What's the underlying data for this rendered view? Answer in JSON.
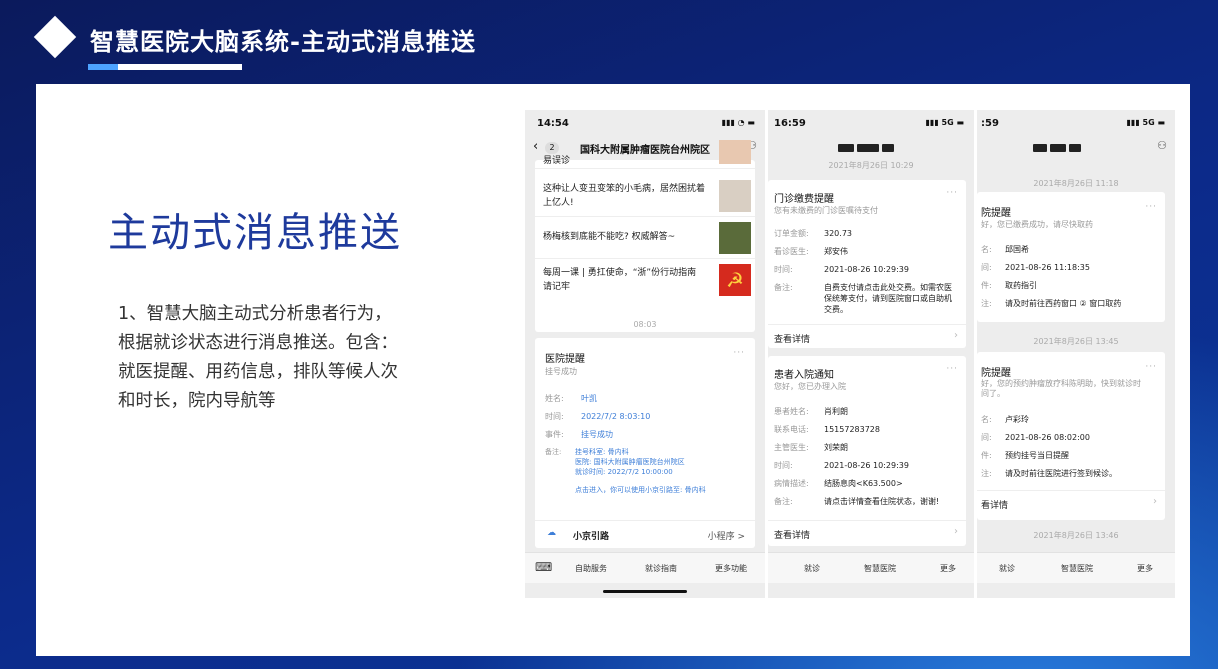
{
  "header": {
    "title": "智慧医院大脑系统-主动式消息推送"
  },
  "main": {
    "title": "主动式消息推送",
    "description": "1、智慧大脑主动式分析患者行为，根据就诊状态进行消息推送。包含：就医提醒、用药信息，排队等候人次和时长，院内导航等"
  },
  "phone1": {
    "time": "14:54",
    "status_icons": "▮▮▮ ◔ ▬",
    "back_count": "2",
    "title": "国科大附属肿瘤医院台州院区",
    "news": [
      {
        "text": "易误诊"
      },
      {
        "text": "这种让人变丑变笨的小毛病，居然困扰着上亿人!"
      },
      {
        "text": "杨梅核到底能不能吃? 权威解答~"
      },
      {
        "text": "每周一课 | 勇扛使命，“浙”份行动指南请记牢"
      }
    ],
    "timestamp": "08:03",
    "card": {
      "title": "医院提醒",
      "subtitle": "挂号成功",
      "more": "···",
      "rows": [
        {
          "k": "姓名:",
          "v": "叶凯"
        },
        {
          "k": "时间:",
          "v": "2022/7/2 8:03:10"
        },
        {
          "k": "事件:",
          "v": "挂号成功"
        }
      ],
      "remark_key": "备注:",
      "remark_lines": [
        "挂号科室: 骨内科",
        "医院: 国科大附属肿瘤医院台州院区",
        "就诊时间: 2022/7/2 10:00:00"
      ],
      "remark_tip": "点击进入，你可以使用小京引路至: 骨内科",
      "footer_name": "小京引路",
      "footer_link": "小程序 >"
    },
    "bottom": [
      "自助服务",
      "就诊指南",
      "更多功能"
    ]
  },
  "phone2": {
    "time": "16:59",
    "status_icons": "▮▮▮ 5G ▬",
    "timestamp1": "2021年8月26日 10:29",
    "card1": {
      "title": "门诊缴费提醒",
      "subtitle": "您有未缴费的门诊医嘱待支付",
      "more": "···",
      "rows": [
        {
          "k": "订单金额:",
          "v": "320.73"
        },
        {
          "k": "看诊医生:",
          "v": "郑安伟"
        },
        {
          "k": "时间:",
          "v": "2021-08-26 10:29:39"
        },
        {
          "k": "备注:",
          "v": "自费支付请点击此处交费。如需农医保统筹支付，请到医院窗口或自助机交费。"
        }
      ],
      "detail": "查看详情"
    },
    "card2": {
      "title": "患者入院通知",
      "subtitle": "您好，您已办理入院",
      "more": "···",
      "rows": [
        {
          "k": "患者姓名:",
          "v": "肖利朗"
        },
        {
          "k": "联系电话:",
          "v": "15157283728"
        },
        {
          "k": "主管医生:",
          "v": "刘荣朗"
        },
        {
          "k": "时间:",
          "v": "2021-08-26 10:29:39"
        },
        {
          "k": "病情描述:",
          "v": "结肠息肉<K63.500>"
        },
        {
          "k": "备注:",
          "v": "请点击详情查看住院状态，谢谢!"
        }
      ],
      "detail": "查看详情"
    },
    "bottom": [
      "就诊",
      "智慧医院",
      "更多"
    ]
  },
  "phone3": {
    "time": ":59",
    "status_icons": "▮▮▮ 5G ▬",
    "timestamp1": "2021年8月26日 11:18",
    "card1": {
      "title": "院提醒",
      "subtitle": "好，您已缴费成功，请尽快取药",
      "more": "···",
      "rows": [
        {
          "k": "名:",
          "v": "邱国希"
        },
        {
          "k": "间:",
          "v": "2021-08-26 11:18:35"
        },
        {
          "k": "件:",
          "v": "取药指引"
        },
        {
          "k": "注:",
          "v": "请及时前往西药窗口 ② 窗口取药"
        }
      ]
    },
    "timestamp2": "2021年8月26日 13:45",
    "card2": {
      "title": "院提醒",
      "subtitle": "好，您的预约肿瘤放疗科陈明助，快到就诊时间了。",
      "more": "···",
      "rows": [
        {
          "k": "名:",
          "v": "卢彩玲"
        },
        {
          "k": "间:",
          "v": "2021-08-26 08:02:00"
        },
        {
          "k": "件:",
          "v": "预约挂号当日提醒"
        },
        {
          "k": "注:",
          "v": "请及时前往医院进行签到候诊。"
        }
      ],
      "detail": "看详情"
    },
    "timestamp3": "2021年8月26日 13:46",
    "bottom": [
      "就诊",
      "智慧医院",
      "更多"
    ]
  }
}
